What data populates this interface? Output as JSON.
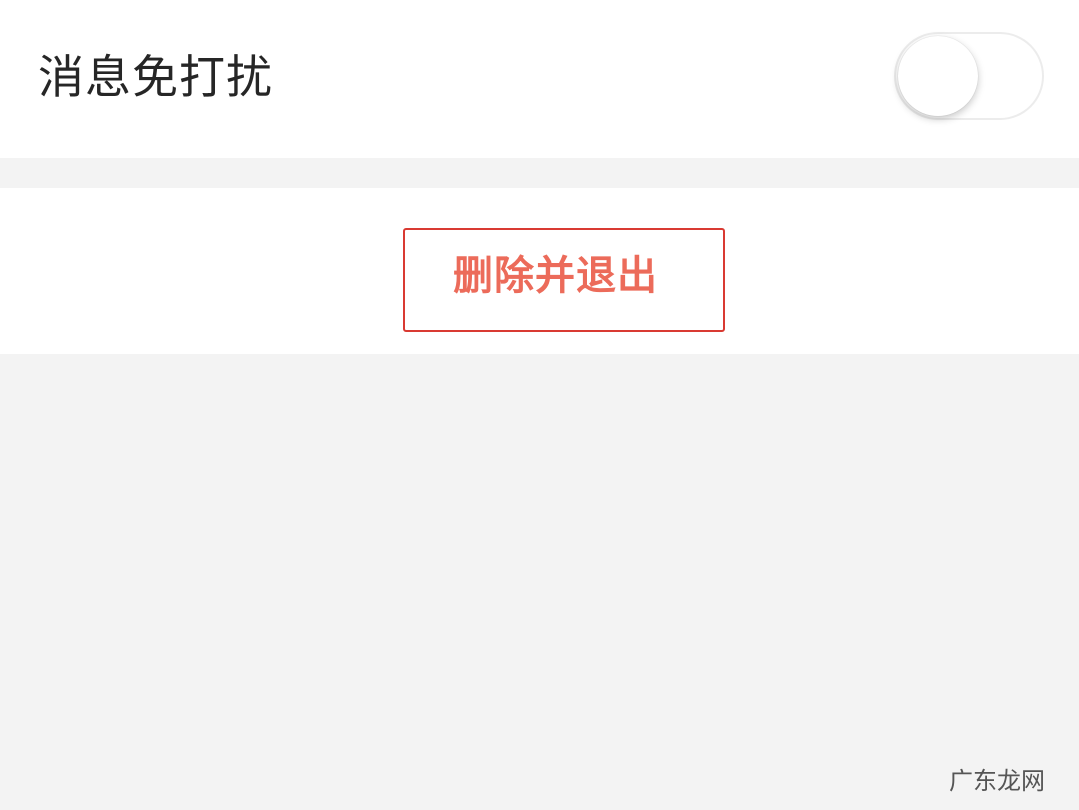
{
  "do_not_disturb": {
    "label": "消息免打扰",
    "enabled": false
  },
  "actions": {
    "delete_and_exit_label": "删除并退出"
  },
  "watermark": {
    "text": "广东龙网"
  },
  "colors": {
    "background": "#f3f3f3",
    "surface": "#ffffff",
    "danger_border": "#d93a32",
    "danger_text": "#ec6b5a"
  }
}
